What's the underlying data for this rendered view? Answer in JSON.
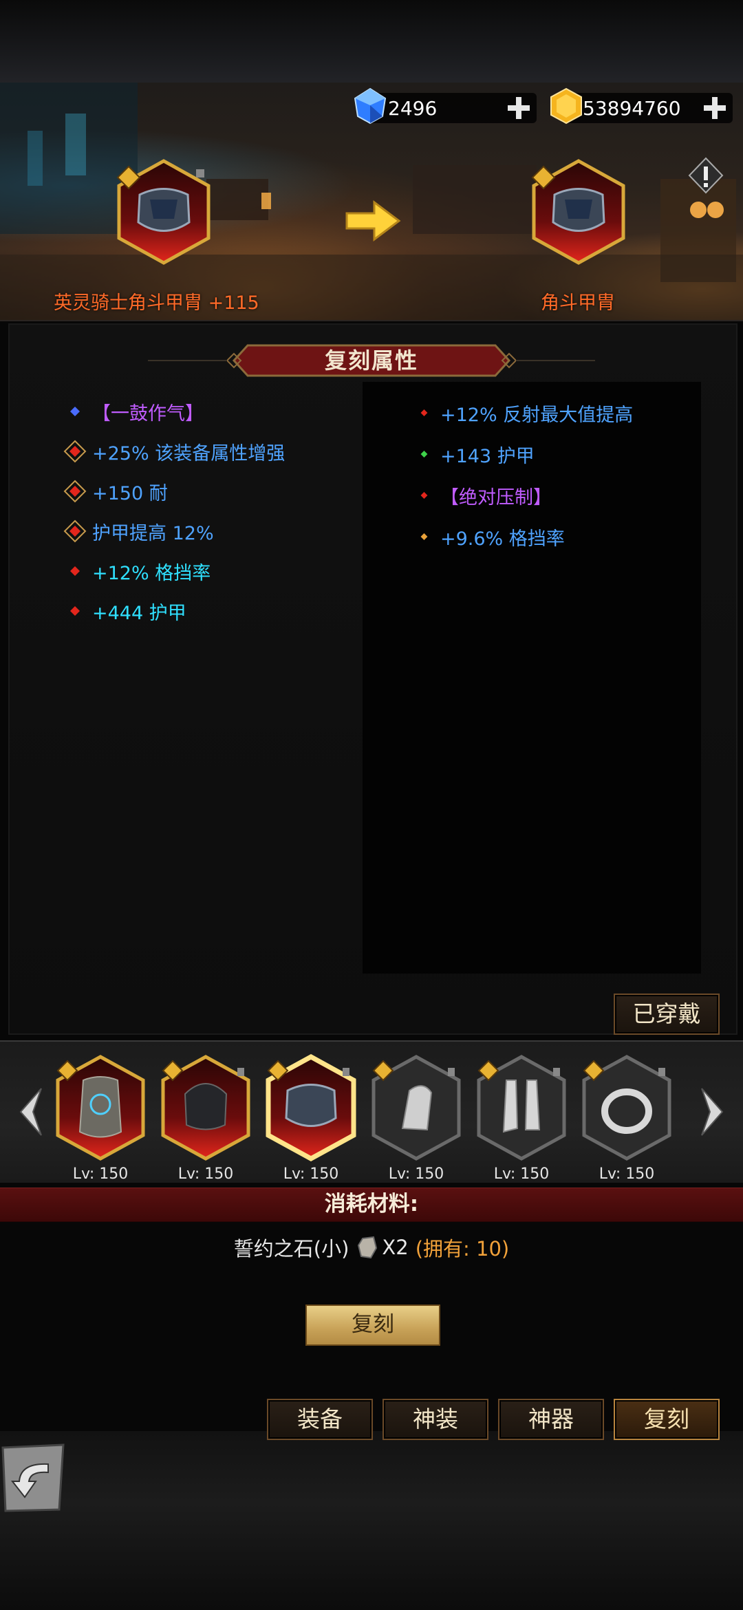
{
  "currency": {
    "gems": "2496",
    "gold": "53894760"
  },
  "upgrade": {
    "from_name": "英灵骑士角斗甲胄 +115",
    "to_name": "角斗甲胄"
  },
  "panel": {
    "title": "复刻属性",
    "left_attrs": [
      {
        "text": "【一鼓作气】",
        "color": "purple",
        "bullet": "blue-diamond"
      },
      {
        "text": "+25% 该装备属性增强",
        "color": "blue",
        "bullet": "ornate-red"
      },
      {
        "text": "+150 耐",
        "color": "blue",
        "bullet": "ornate-red"
      },
      {
        "text": "护甲提高 12%",
        "color": "blue",
        "bullet": "ornate-red"
      },
      {
        "text": "+12% 格挡率",
        "color": "cyan",
        "bullet": "red-diamond"
      },
      {
        "text": "+444 护甲",
        "color": "cyan",
        "bullet": "red-diamond"
      }
    ],
    "right_attrs": [
      {
        "text": "+12% 反射最大值提高",
        "color": "blue",
        "bullet": "red-diamond"
      },
      {
        "text": "+143 护甲",
        "color": "blue",
        "bullet": "green-diamond"
      },
      {
        "text": "【绝对压制】",
        "color": "purple",
        "bullet": "red-diamond"
      },
      {
        "text": "+9.6% 格挡率",
        "color": "blue",
        "bullet": "orange-diamond"
      }
    ],
    "worn_label": "已穿戴"
  },
  "equipment": {
    "slots": [
      {
        "icon": "cloak-icon",
        "level": "Lv: 150",
        "rarity": "red"
      },
      {
        "icon": "helmet-icon",
        "level": "Lv: 150",
        "rarity": "red"
      },
      {
        "icon": "armor-icon",
        "level": "Lv: 150",
        "rarity": "red-selected"
      },
      {
        "icon": "gauntlet-icon",
        "level": "Lv: 150",
        "rarity": "gray"
      },
      {
        "icon": "boots-icon",
        "level": "Lv: 150",
        "rarity": "gray"
      },
      {
        "icon": "ring-icon",
        "level": "Lv: 150",
        "rarity": "gray"
      }
    ]
  },
  "materials": {
    "title": "消耗材料:",
    "item_name": "誓约之石(小)",
    "quantity": "X2",
    "owned": "(拥有: 10)"
  },
  "actions": {
    "copy_button": "复刻"
  },
  "tabs": [
    {
      "label": "装备",
      "active": false
    },
    {
      "label": "神装",
      "active": false
    },
    {
      "label": "神器",
      "active": false
    },
    {
      "label": "复刻",
      "active": true
    }
  ],
  "colors": {
    "purple": "#c05cff",
    "blue": "#4fa3ff",
    "cyan": "#2fe0ff",
    "name_orange": "#ff6a28",
    "material_banner": "#5a1010"
  }
}
